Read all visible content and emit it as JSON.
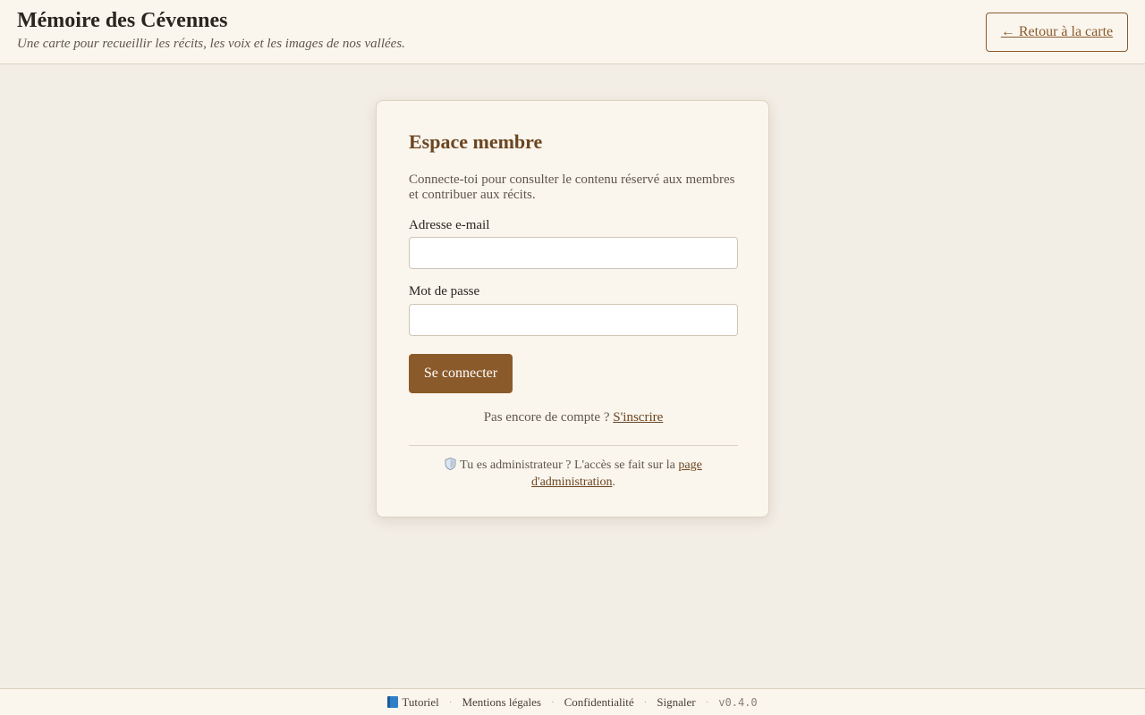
{
  "header": {
    "title": "Mémoire des Cévennes",
    "subtitle": "Une carte pour recueillir les récits, les voix et les images de nos vallées.",
    "back_label": "← Retour à la carte"
  },
  "login": {
    "title": "Espace membre",
    "description": "Connecte-toi pour consulter le contenu réservé aux membres et contribuer aux récits.",
    "email_label": "Adresse e-mail",
    "email_value": "",
    "password_label": "Mot de passe",
    "password_value": "",
    "submit_label": "Se connecter",
    "signup_prompt": "Pas encore de compte ?",
    "signup_link": "S'inscrire",
    "admin_text": "Tu es administrateur ? L'accès se fait sur la",
    "admin_link": "page d'administration",
    "admin_end": "."
  },
  "footer": {
    "items": [
      "Tutoriel",
      "Mentions légales",
      "Confidentialité",
      "Signaler"
    ],
    "version": "v0.4.0"
  },
  "colors": {
    "accent": "#8b5a2b",
    "background": "#f2ede5",
    "panel": "#faf6ee"
  },
  "icons": {
    "tutorial": "book-icon",
    "admin": "shield-icon"
  }
}
